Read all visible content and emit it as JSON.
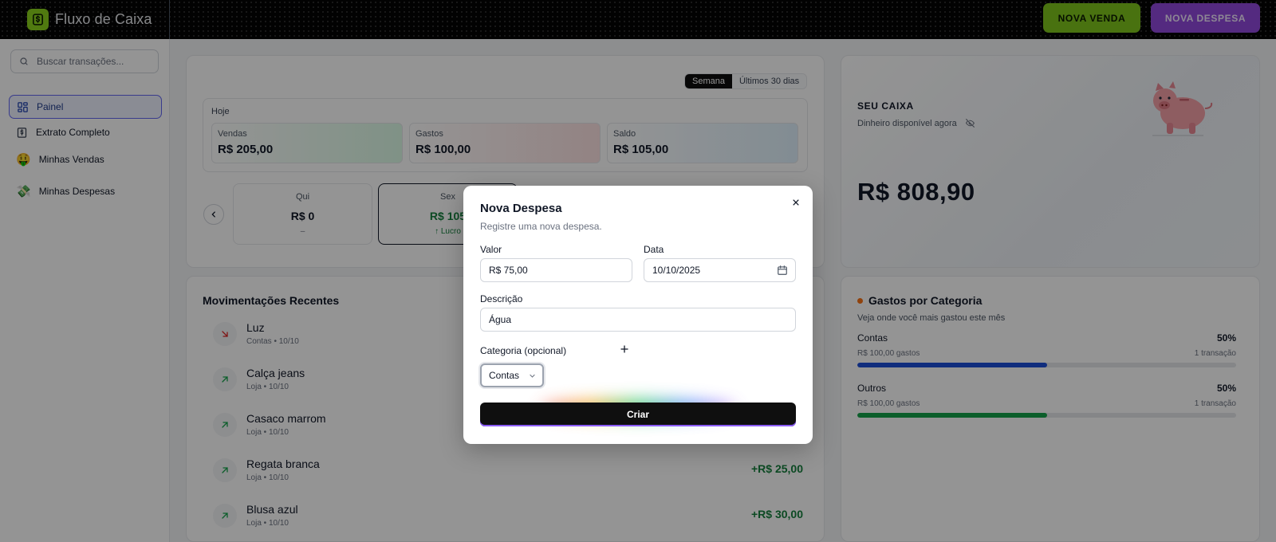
{
  "app": {
    "title": "Fluxo de Caixa"
  },
  "header": {
    "nova_venda": "NOVA VENDA",
    "nova_despesa": "NOVA DESPESA"
  },
  "sidebar": {
    "search_placeholder": "Buscar transações...",
    "items": [
      {
        "label": "Painel",
        "icon": "grid-icon",
        "active": true
      },
      {
        "label": "Extrato Completo",
        "icon": "statement-icon"
      },
      {
        "label": "Minhas Vendas",
        "icon": "money-face-emoji"
      },
      {
        "label": "Minhas Despesas",
        "icon": "flying-money-emoji"
      }
    ]
  },
  "summary": {
    "periods": [
      "Semana",
      "Últimos 30 dias"
    ],
    "today_label": "Hoje",
    "today": [
      {
        "label": "Vendas",
        "value": "R$ 205,00",
        "color": "#dcfce7"
      },
      {
        "label": "Gastos",
        "value": "R$ 100,00",
        "color": "#fee2e2"
      },
      {
        "label": "Saldo",
        "value": "R$ 105,00",
        "color": "#e0f2fe"
      }
    ],
    "days": [
      {
        "name": "Qui",
        "value": "R$ 0",
        "sub": "–"
      },
      {
        "name": "Sex",
        "value": "R$ 105",
        "sub": "↑ Lucro"
      }
    ]
  },
  "movements": {
    "title": "Movimentações Recentes",
    "items": [
      {
        "name": "Luz",
        "sub": "Contas • 10/10",
        "amount": "",
        "type": "out"
      },
      {
        "name": "Calça jeans",
        "sub": "Loja • 10/10",
        "amount": "",
        "type": "in"
      },
      {
        "name": "Casaco marrom",
        "sub": "Loja • 10/10",
        "amount": "",
        "type": "in"
      },
      {
        "name": "Regata branca",
        "sub": "Loja • 10/10",
        "amount": "+R$ 25,00",
        "type": "in"
      },
      {
        "name": "Blusa azul",
        "sub": "Loja • 10/10",
        "amount": "+R$ 30,00",
        "type": "in"
      }
    ]
  },
  "caixa": {
    "title": "SEU CAIXA",
    "subtitle": "Dinheiro disponível agora",
    "value": "R$ 808,90"
  },
  "categories": {
    "title": "Gastos por Categoria",
    "subtitle": "Veja onde você mais gastou este mês",
    "items": [
      {
        "name": "Contas",
        "percent": "50%",
        "spent": "R$ 100,00 gastos",
        "count": "1 transação",
        "fraction": 0.5,
        "color": "#1d4ed8"
      },
      {
        "name": "Outros",
        "percent": "50%",
        "spent": "R$ 100,00 gastos",
        "count": "1 transação",
        "fraction": 0.5,
        "color": "#16a34a"
      }
    ]
  },
  "modal": {
    "title": "Nova Despesa",
    "subtitle": "Registre uma nova despesa.",
    "valor_label": "Valor",
    "valor_value": "R$ 75,00",
    "data_label": "Data",
    "data_value": "10/10/2025",
    "descricao_label": "Descrição",
    "descricao_value": "Água",
    "categoria_label": "Categoria (opcional)",
    "categoria_value": "Contas",
    "submit_label": "Criar"
  }
}
